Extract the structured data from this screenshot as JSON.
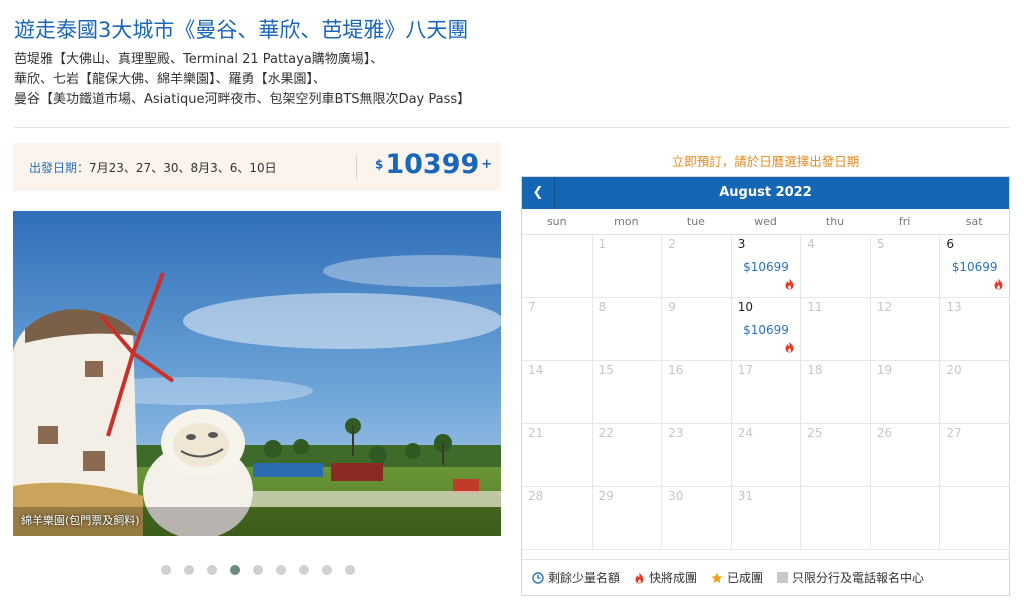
{
  "tour": {
    "title": "遊走泰國3大城市《曼谷、華欣、芭堤雅》八天團",
    "desc": [
      "芭堤雅【大佛山、真理聖殿、Terminal 21 Pattaya購物廣場】、",
      "華欣、七岩【龍保大佛、綿羊樂園】、羅勇【水果園】、",
      "曼谷【美功鐵道市場、Asiatique河畔夜市、包架空列車BTS無限次Day Pass】"
    ]
  },
  "departure": {
    "label": "出發日期：",
    "dates": "7月23、27、30、8月3、6、10日"
  },
  "price": {
    "currency": "$",
    "amount": "10399",
    "suffix": "+"
  },
  "photo": {
    "caption": "綿羊樂園(包門票及飼料)",
    "slide_count": 9,
    "active_slide": 4
  },
  "calendar": {
    "prompt": "立即預訂，請於日曆選擇出發日期",
    "prev_label": "❮",
    "month": "August 2022",
    "weekdays": [
      "sun",
      "mon",
      "tue",
      "wed",
      "thu",
      "fri",
      "sat"
    ],
    "weeks": [
      [
        null,
        {
          "d": "1"
        },
        {
          "d": "2"
        },
        {
          "d": "3",
          "price": "$10699",
          "hot": true
        },
        {
          "d": "4"
        },
        {
          "d": "5"
        },
        {
          "d": "6",
          "price": "$10699",
          "hot": true
        }
      ],
      [
        {
          "d": "7"
        },
        {
          "d": "8"
        },
        {
          "d": "9"
        },
        {
          "d": "10",
          "price": "$10699",
          "hot": true
        },
        {
          "d": "11"
        },
        {
          "d": "12"
        },
        {
          "d": "13"
        }
      ],
      [
        {
          "d": "14"
        },
        {
          "d": "15"
        },
        {
          "d": "16"
        },
        {
          "d": "17"
        },
        {
          "d": "18"
        },
        {
          "d": "19"
        },
        {
          "d": "20"
        }
      ],
      [
        {
          "d": "21"
        },
        {
          "d": "22"
        },
        {
          "d": "23"
        },
        {
          "d": "24"
        },
        {
          "d": "25"
        },
        {
          "d": "26"
        },
        {
          "d": "27"
        }
      ],
      [
        {
          "d": "28"
        },
        {
          "d": "29"
        },
        {
          "d": "30"
        },
        {
          "d": "31"
        },
        null,
        null,
        null
      ]
    ],
    "legend": {
      "few_seats": "剩餘少量名額",
      "almost": "快將成團",
      "confirmed": "已成團",
      "branch_only": "只限分行及電話報名中心"
    }
  },
  "colors": {
    "brand_blue": "#1566b4",
    "accent_orange": "#e58a20",
    "hot_red": "#e53b2b",
    "star": "#f0a21e"
  }
}
